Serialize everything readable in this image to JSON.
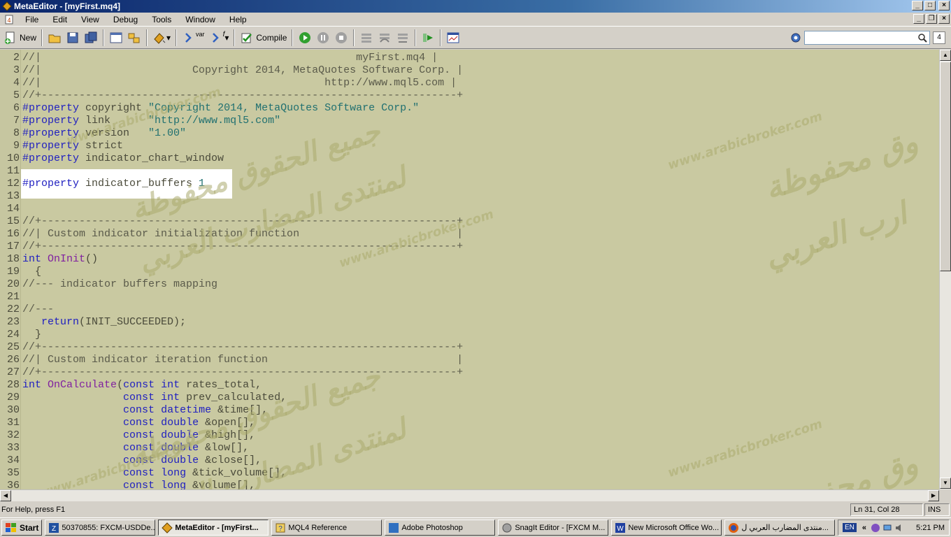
{
  "window": {
    "title": "MetaEditor - [myFirst.mq4]"
  },
  "menu": {
    "items": [
      "File",
      "Edit",
      "View",
      "Debug",
      "Tools",
      "Window",
      "Help"
    ]
  },
  "toolbar": {
    "new_label": "New",
    "compile_label": "Compile",
    "var_label": "var",
    "f_label": "f",
    "search_value": "",
    "search_count": "4"
  },
  "editor": {
    "lines": [
      {
        "n": "2",
        "text": "//|                                                  myFirst.mq4 |"
      },
      {
        "n": "3",
        "text": "//|                        Copyright 2014, MetaQuotes Software Corp. |"
      },
      {
        "n": "4",
        "text": "//|                                             http://www.mql5.com |"
      },
      {
        "n": "5",
        "text": "//+------------------------------------------------------------------+"
      },
      {
        "n": "6",
        "text": "#property copyright \"Copyright 2014, MetaQuotes Software Corp.\""
      },
      {
        "n": "7",
        "text": "#property link      \"http://www.mql5.com\""
      },
      {
        "n": "8",
        "text": "#property version   \"1.00\""
      },
      {
        "n": "9",
        "text": "#property strict"
      },
      {
        "n": "10",
        "text": "#property indicator_chart_window"
      },
      {
        "n": "11",
        "text": ""
      },
      {
        "n": "12",
        "text": "#property indicator_buffers 1"
      },
      {
        "n": "13",
        "text": ""
      },
      {
        "n": "14",
        "text": ""
      },
      {
        "n": "15",
        "text": "//+------------------------------------------------------------------+"
      },
      {
        "n": "16",
        "text": "//| Custom indicator initialization function                         |"
      },
      {
        "n": "17",
        "text": "//+------------------------------------------------------------------+"
      },
      {
        "n": "18",
        "text": "int OnInit()"
      },
      {
        "n": "19",
        "text": "  {"
      },
      {
        "n": "20",
        "text": "//--- indicator buffers mapping"
      },
      {
        "n": "21",
        "text": ""
      },
      {
        "n": "22",
        "text": "//---"
      },
      {
        "n": "23",
        "text": "   return(INIT_SUCCEEDED);"
      },
      {
        "n": "24",
        "text": "  }"
      },
      {
        "n": "25",
        "text": "//+------------------------------------------------------------------+"
      },
      {
        "n": "26",
        "text": "//| Custom indicator iteration function                              |"
      },
      {
        "n": "27",
        "text": "//+------------------------------------------------------------------+"
      },
      {
        "n": "28",
        "text": "int OnCalculate(const int rates_total,"
      },
      {
        "n": "29",
        "text": "                const int prev_calculated,"
      },
      {
        "n": "30",
        "text": "                const datetime &time[],"
      },
      {
        "n": "31",
        "text": "                const double &open[],"
      },
      {
        "n": "32",
        "text": "                const double &high[],"
      },
      {
        "n": "33",
        "text": "                const double &low[],"
      },
      {
        "n": "34",
        "text": "                const double &close[],"
      },
      {
        "n": "35",
        "text": "                const long &tick_volume[],"
      },
      {
        "n": "36",
        "text": "                const long &volume[],"
      }
    ]
  },
  "watermark": {
    "url": "www.arabicbroker.com",
    "arabic_1": "جميع الحقوق محفوظة",
    "arabic_2": "لمنتدى المضارب العربي",
    "arabic_3": "وق محفوظة",
    "arabic_4": "ارب العربي"
  },
  "status": {
    "help": "For Help, press F1",
    "position": "Ln 31, Col 28",
    "mode": "INS"
  },
  "taskbar": {
    "start": "Start",
    "tasks": [
      "50370855: FXCM-USDDe...",
      "MetaEditor - [myFirst...",
      "MQL4 Reference",
      "Adobe Photoshop",
      "SnagIt Editor - [FXCM M...",
      "New Microsoft Office Wo...",
      "منتدى المضارب العربي ل..."
    ],
    "lang": "EN",
    "chevron": "«",
    "clock": "5:21 PM"
  },
  "colors": {
    "editor_bg": "#c9c9a1",
    "keyword": "#2020c0",
    "function": "#8020a0",
    "string": "#207070",
    "highlight": "#ffffff",
    "title_gradient_start": "#0a246a"
  }
}
